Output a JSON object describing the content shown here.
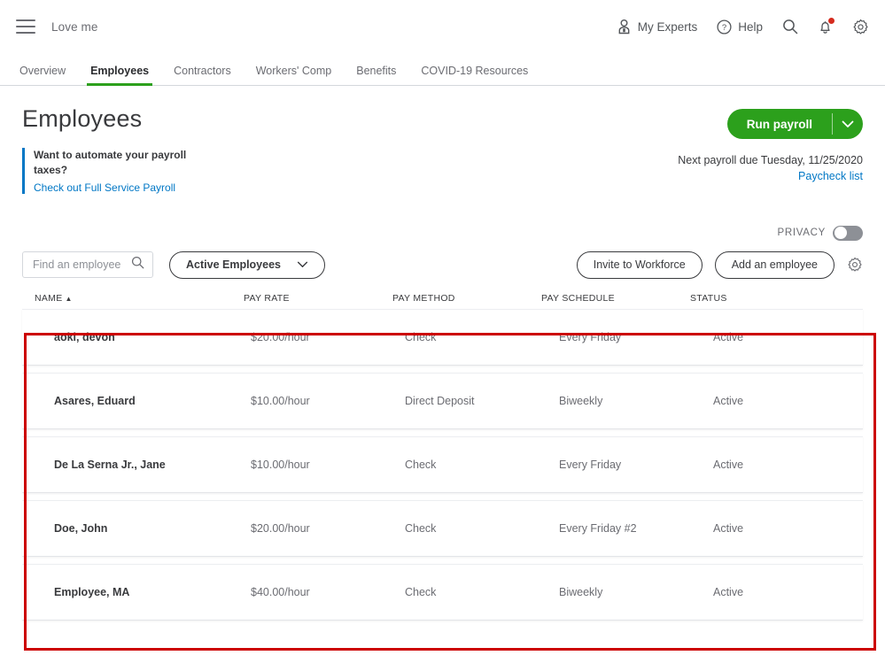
{
  "topbar": {
    "menu_icon": "hamburger-menu-icon",
    "company": "Love me",
    "my_experts": "My Experts",
    "help": "Help",
    "search_icon": "search-icon",
    "notifications_icon": "bell-icon",
    "settings_icon": "gear-icon"
  },
  "tabs": [
    {
      "label": "Overview",
      "active": false
    },
    {
      "label": "Employees",
      "active": true
    },
    {
      "label": "Contractors",
      "active": false
    },
    {
      "label": "Workers' Comp",
      "active": false
    },
    {
      "label": "Benefits",
      "active": false
    },
    {
      "label": "COVID-19 Resources",
      "active": false
    }
  ],
  "page": {
    "title": "Employees",
    "promo_text": "Want to automate your payroll taxes?",
    "promo_link": "Check out Full Service Payroll",
    "run_payroll_label": "Run payroll",
    "next_payroll": "Next payroll due Tuesday, 11/25/2020",
    "paycheck_list_link": "Paycheck list",
    "privacy_label": "PRIVACY",
    "privacy_on": false
  },
  "toolbar": {
    "search_placeholder": "Find an employee",
    "search_value": "",
    "filter_label": "Active Employees",
    "invite_label": "Invite to Workforce",
    "add_employee_label": "Add an employee",
    "settings_icon": "gear-icon"
  },
  "table": {
    "columns": [
      "NAME",
      "PAY RATE",
      "PAY METHOD",
      "PAY SCHEDULE",
      "STATUS"
    ],
    "sort_column": "NAME",
    "sort_direction": "ascending",
    "rows": [
      {
        "name": "aoki, devon",
        "pay_rate": "$20.00/hour",
        "pay_method": "Check",
        "pay_schedule": "Every Friday",
        "status": "Active"
      },
      {
        "name": "Asares, Eduard",
        "pay_rate": "$10.00/hour",
        "pay_method": "Direct Deposit",
        "pay_schedule": "Biweekly",
        "status": "Active"
      },
      {
        "name": "De La Serna Jr., Jane",
        "pay_rate": "$10.00/hour",
        "pay_method": "Check",
        "pay_schedule": "Every Friday",
        "status": "Active"
      },
      {
        "name": "Doe, John",
        "pay_rate": "$20.00/hour",
        "pay_method": "Check",
        "pay_schedule": "Every Friday #2",
        "status": "Active"
      },
      {
        "name": "Employee, MA",
        "pay_rate": "$40.00/hour",
        "pay_method": "Check",
        "pay_schedule": "Biweekly",
        "status": "Active"
      }
    ]
  },
  "colors": {
    "accent_green": "#2ca01c",
    "link_blue": "#0077c5",
    "annotation_red": "#cc0000",
    "alert_red": "#d52b1e"
  }
}
